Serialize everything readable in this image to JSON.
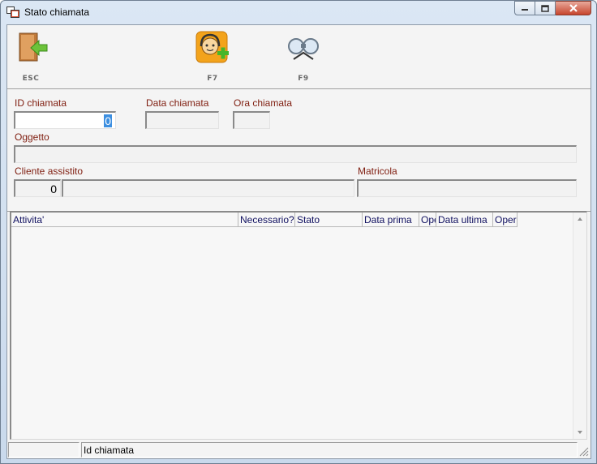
{
  "window": {
    "title": "Stato chiamata"
  },
  "toolbar": {
    "esc_label": "ESC",
    "f7_label": "F7",
    "f9_label": "F9"
  },
  "form": {
    "id_chiamata": {
      "label": "ID chiamata",
      "value": "0"
    },
    "data_chiamata": {
      "label": "Data chiamata",
      "value": ""
    },
    "ora_chiamata": {
      "label": "Ora chiamata",
      "value": ""
    },
    "oggetto": {
      "label": "Oggetto",
      "value": ""
    },
    "cliente_assistito": {
      "label": "Cliente assistito",
      "code": "0",
      "name": ""
    },
    "matricola": {
      "label": "Matricola",
      "value": ""
    }
  },
  "grid": {
    "columns": [
      "Attivita'",
      "Necessario?",
      "Stato",
      "Data prima",
      "Operatore",
      "Data ultima",
      "Operatore"
    ]
  },
  "status": {
    "panel1": "",
    "panel2": "Id chiamata"
  },
  "colors": {
    "label": "#7f1d0f",
    "header_text": "#101060",
    "selection": "#3d8fe0"
  }
}
